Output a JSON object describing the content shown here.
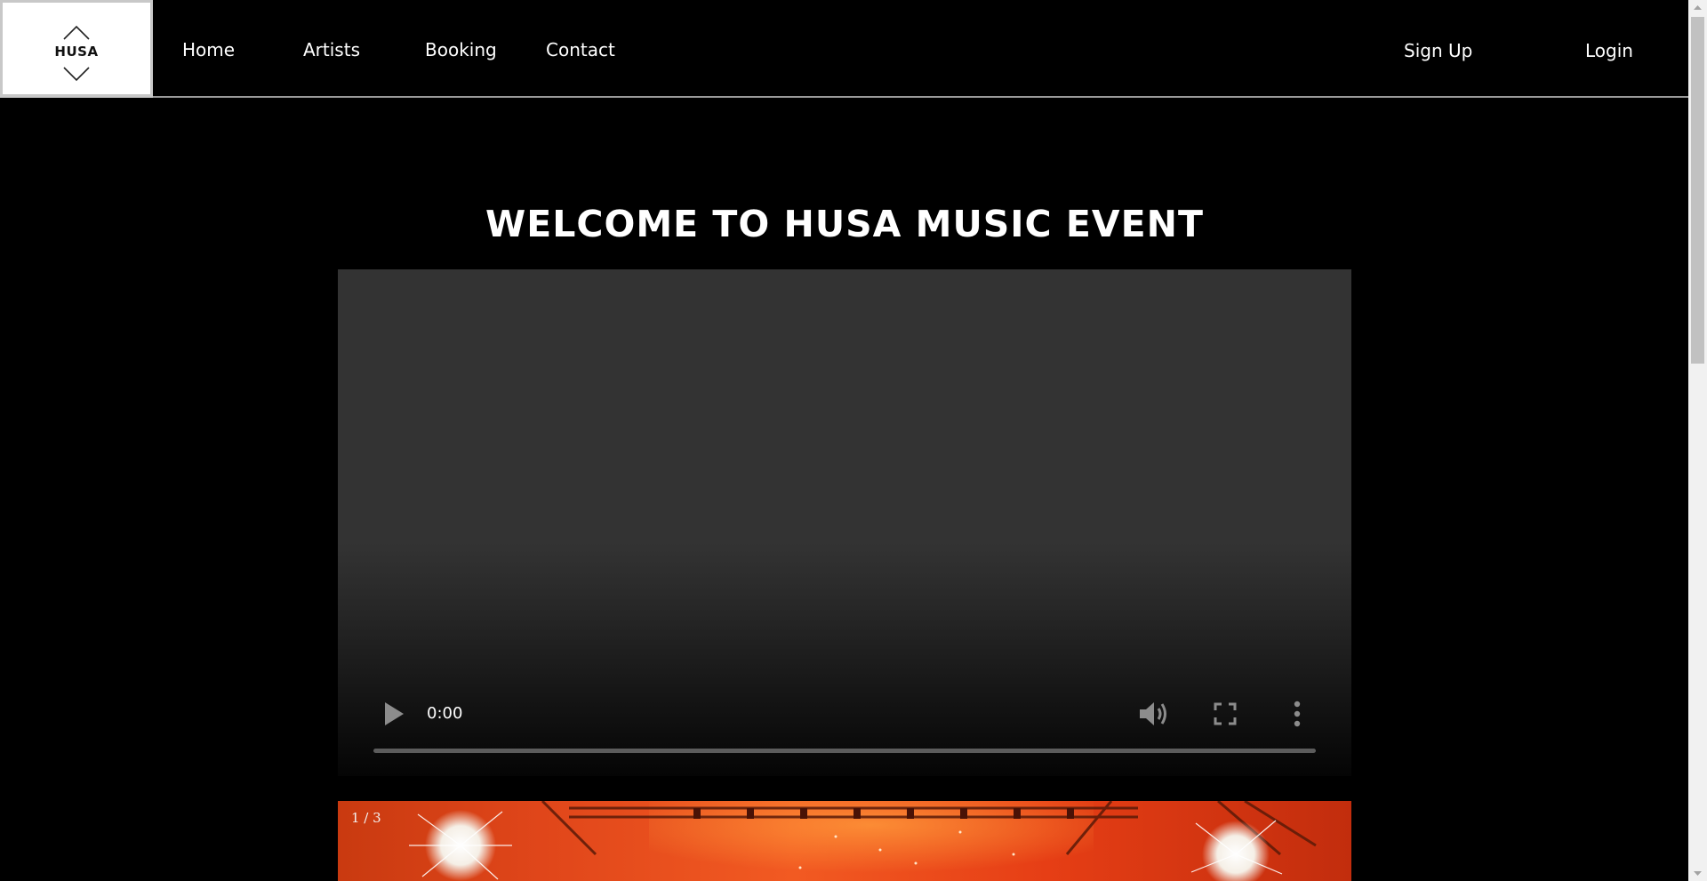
{
  "header": {
    "logo_text": "HUSA",
    "nav": [
      "Home",
      "Artists",
      "Booking",
      "Contact"
    ],
    "signup_label": "Sign Up",
    "login_label": "Login"
  },
  "main": {
    "title": "WELCOME TO HUSA MUSIC EVENT"
  },
  "video": {
    "current_time": "0:00",
    "progress": 0,
    "icons": [
      "play-icon",
      "volume-icon",
      "fullscreen-icon",
      "more-vert-icon"
    ]
  },
  "slideshow": {
    "counter": "1 / 3"
  },
  "colors": {
    "background": "#000000",
    "text": "#ffffff",
    "header_border": "#9a9a9a",
    "video_bg": "#333333",
    "slide_accent": "#f25a22"
  }
}
